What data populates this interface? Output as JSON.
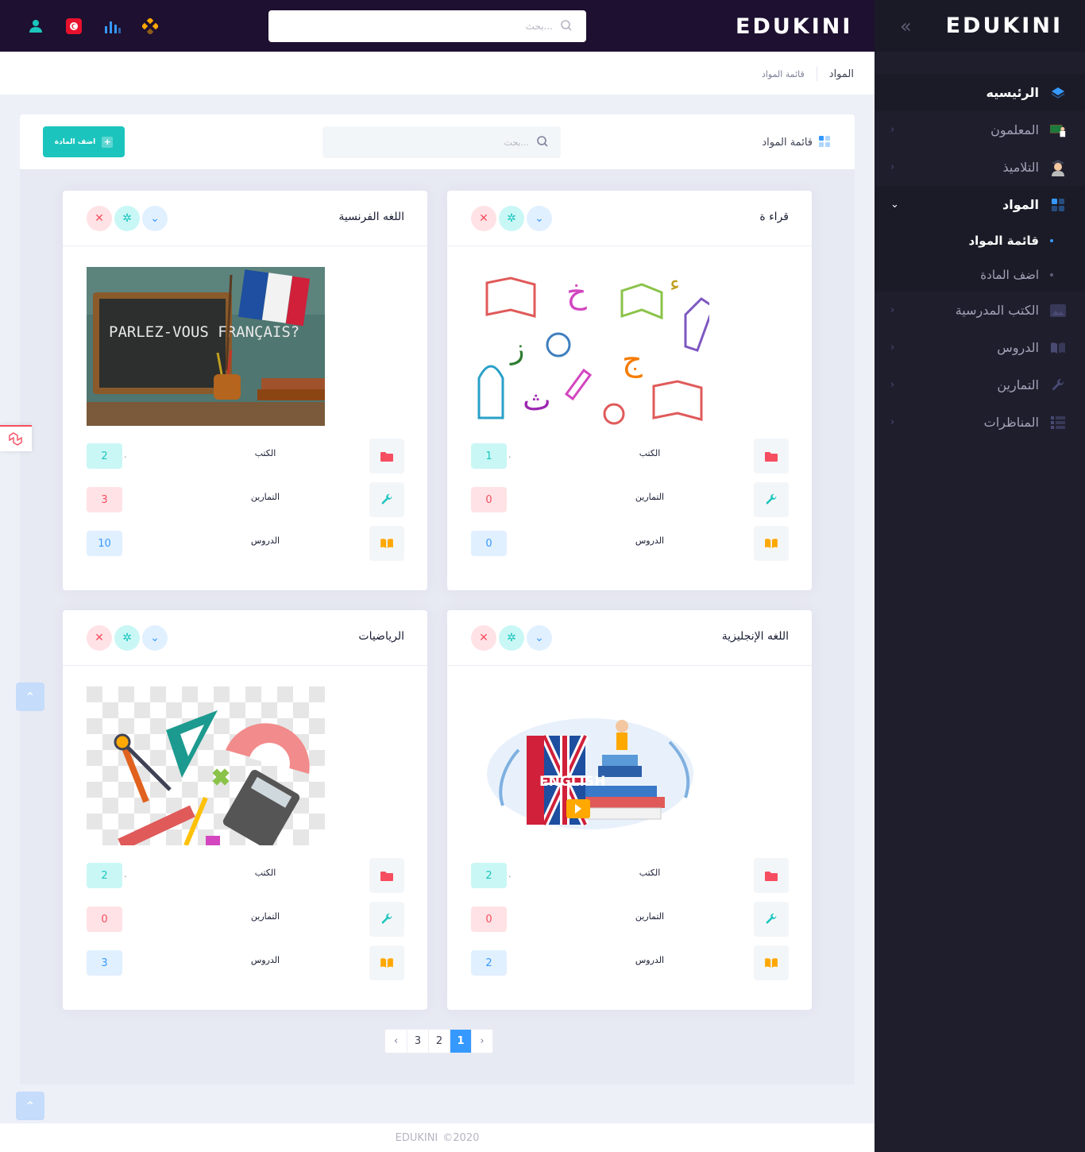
{
  "app": {
    "logo": "EDUKINI"
  },
  "header": {
    "search_placeholder": "بحث..."
  },
  "sidebar": {
    "items": [
      {
        "label": "الرئيسيه",
        "icon": "layers-icon",
        "color": "#3699ff"
      },
      {
        "label": "المعلمون",
        "icon": "teacher-icon",
        "color": "#1bc5bd"
      },
      {
        "label": "التلاميذ",
        "icon": "student-icon",
        "color": "#a2a3b7"
      },
      {
        "label": "المواد",
        "icon": "grid-icon",
        "color": "#3699ff"
      },
      {
        "label": "الكتب المدرسية",
        "icon": "image-icon",
        "color": "#494b74"
      },
      {
        "label": "الدروس",
        "icon": "book-icon",
        "color": "#494b74"
      },
      {
        "label": "التمارين",
        "icon": "wrench-icon",
        "color": "#494b74"
      },
      {
        "label": "المناظرات",
        "icon": "list-icon",
        "color": "#494b74"
      }
    ],
    "submenu": [
      {
        "label": "قائمة المواد",
        "active": true
      },
      {
        "label": "اضف المادة",
        "active": false
      }
    ]
  },
  "breadcrumb": {
    "main": "المواد",
    "sub": "قائمة المواد"
  },
  "panel": {
    "title": "قائمة المواد",
    "search_placeholder": "بحث...",
    "add_button": "اضف المادة"
  },
  "stat_labels": {
    "books": "الكتب",
    "exercises": "التمارين",
    "lessons": "الدروس"
  },
  "cards": [
    {
      "title": "قراء ة",
      "books": "1",
      "exercises": "0",
      "lessons": "0",
      "image": "arabic-letters"
    },
    {
      "title": "اللغه الفرنسية",
      "books": "2",
      "exercises": "3",
      "lessons": "10",
      "image": "parlez-vous-francais",
      "image_text": "PARLEZ-VOUS FRANÇAIS?"
    },
    {
      "title": "اللغه الإنجليزية",
      "books": "2",
      "exercises": "0",
      "lessons": "2",
      "image": "english-books",
      "image_text": "ENGLISH"
    },
    {
      "title": "الرياضيات",
      "books": "2",
      "exercises": "0",
      "lessons": "3",
      "image": "math-tools"
    }
  ],
  "pagination": {
    "prev": "‹",
    "pages": [
      "3",
      "2",
      "1"
    ],
    "active": "1",
    "next": "›"
  },
  "footer": {
    "brand": "EDUKINI",
    "year": "©2020"
  },
  "colors": {
    "accent": "#3699ff",
    "teal": "#1bc5bd",
    "danger": "#f64e60",
    "warning": "#ffa800",
    "header_bg": "#1e1030",
    "sidebar_bg": "#1e1e2d"
  }
}
